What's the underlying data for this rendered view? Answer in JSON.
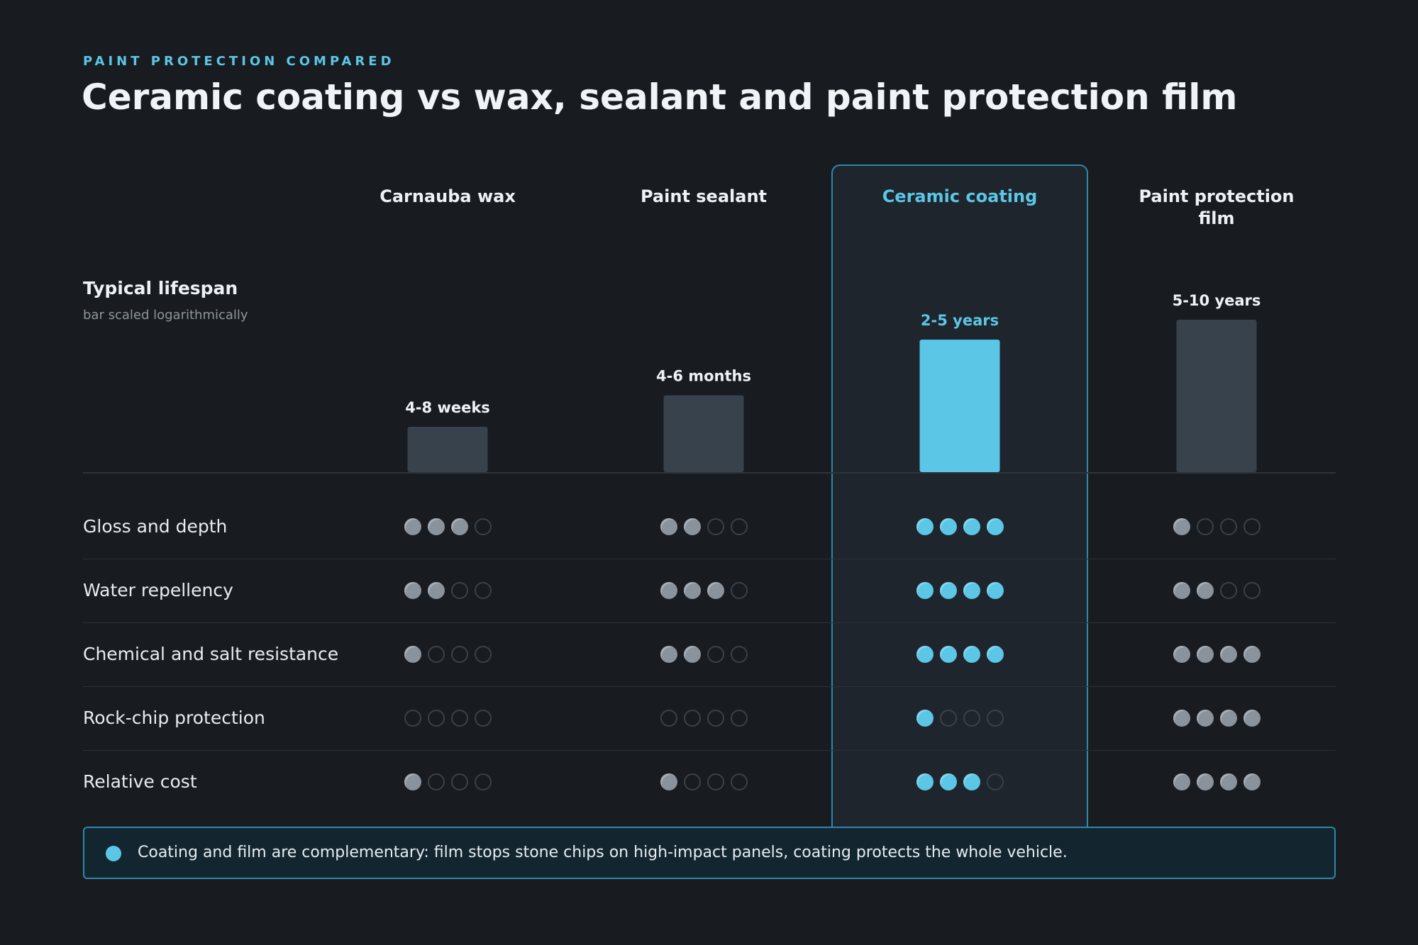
{
  "eyebrow": "PAINT PROTECTION COMPARED",
  "title": "Ceramic coating vs wax, sealant and paint protection film",
  "columns": [
    {
      "name": "Carnauba wax",
      "highlight": false
    },
    {
      "name": "Paint sealant",
      "highlight": false
    },
    {
      "name": "Ceramic coating",
      "highlight": true
    },
    {
      "name": "Paint protection film",
      "highlight": false
    }
  ],
  "lifespan": {
    "title": "Typical lifespan",
    "note": "bar scaled logarithmically"
  },
  "rows": [
    {
      "label": "Gloss and depth"
    },
    {
      "label": "Water repellency"
    },
    {
      "label": "Chemical and salt resistance"
    },
    {
      "label": "Rock-chip protection"
    },
    {
      "label": "Relative cost"
    }
  ],
  "callout": "Coating and film are complementary: film stops stone chips on high-impact panels, coating protects the whole vehicle.",
  "colors": {
    "accent": "#5bc6e6",
    "bar_default": "#37424c",
    "dot_filled": "#8a929c",
    "dot_empty": "#3a4148"
  },
  "chart_data": [
    {
      "type": "bar",
      "scale": "log",
      "categories": [
        "Carnauba wax",
        "Paint sealant",
        "Ceramic coating",
        "Paint protection film"
      ],
      "value_labels": [
        "4-8 weeks",
        "4-6 months",
        "2-5 years",
        "5-10 years"
      ],
      "values_months": [
        1.5,
        5,
        42,
        90
      ],
      "highlight": "Ceramic coating"
    },
    {
      "type": "table",
      "columns": [
        "Carnauba wax",
        "Paint sealant",
        "Ceramic coating",
        "Paint protection film"
      ],
      "max_rating": 4,
      "rows": [
        {
          "label": "Gloss and depth",
          "ratings": [
            3,
            2,
            4,
            1
          ]
        },
        {
          "label": "Water repellency",
          "ratings": [
            2,
            3,
            4,
            2
          ]
        },
        {
          "label": "Chemical and salt resistance",
          "ratings": [
            1,
            2,
            4,
            4
          ]
        },
        {
          "label": "Rock-chip protection",
          "ratings": [
            0,
            0,
            1,
            4
          ]
        },
        {
          "label": "Relative cost",
          "ratings": [
            1,
            1,
            3,
            4
          ]
        }
      ]
    }
  ]
}
